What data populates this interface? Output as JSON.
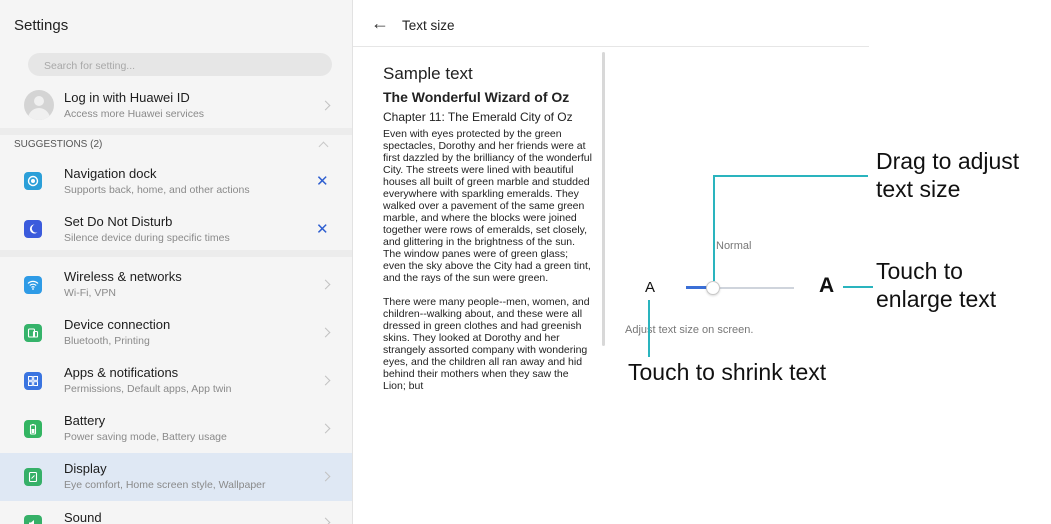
{
  "settings": {
    "title": "Settings",
    "search_placeholder": "Search for setting...",
    "account": {
      "title": "Log in with Huawei ID",
      "subtitle": "Access more Huawei services"
    },
    "suggestions_header": "SUGGESTIONS (2)",
    "suggestions": [
      {
        "title": "Navigation dock",
        "subtitle": "Supports back, home, and other actions",
        "icon": "navigation-dock-icon",
        "color": "#2b9fd8"
      },
      {
        "title": "Set Do Not Disturb",
        "subtitle": "Silence device during specific times",
        "icon": "moon-icon",
        "color": "#3b5bdc"
      }
    ],
    "items": [
      {
        "title": "Wireless & networks",
        "subtitle": "Wi-Fi, VPN",
        "icon": "wifi-icon",
        "color": "#2e9be6"
      },
      {
        "title": "Device connection",
        "subtitle": "Bluetooth, Printing",
        "icon": "device-connection-icon",
        "color": "#35b36a"
      },
      {
        "title": "Apps & notifications",
        "subtitle": "Permissions, Default apps, App twin",
        "icon": "apps-icon",
        "color": "#3a74e0"
      },
      {
        "title": "Battery",
        "subtitle": "Power saving mode, Battery usage",
        "icon": "battery-icon",
        "color": "#33b562"
      },
      {
        "title": "Display",
        "subtitle": "Eye comfort, Home screen style, Wallpaper",
        "icon": "display-icon",
        "color": "#36b068"
      },
      {
        "title": "Sound",
        "subtitle": "",
        "icon": "sound-icon",
        "color": "#36b068"
      }
    ]
  },
  "detail": {
    "title": "Text size",
    "sample_label": "Sample text",
    "book_title": "The Wonderful Wizard of Oz",
    "chapter": "Chapter 11: The Emerald City of Oz",
    "paragraph1": "Even with eyes protected by the green spectacles, Dorothy and her friends were at first dazzled by the brilliancy of the wonderful City. The streets were lined with beautiful houses all built of green marble and studded everywhere with sparkling emeralds. They walked over a pavement of the same green marble, and where the blocks were joined together were rows of emeralds, set closely, and glittering in the brightness of the sun. The window panes were of green glass; even the sky above the City had a green tint, and the rays of the sun were green.",
    "paragraph2": "There were many people--men, women, and children--walking about, and these were all dressed in green clothes and had greenish skins. They looked at Dorothy and her strangely assorted company with wondering eyes, and the children all ran away and hid behind their mothers when they saw the Lion; but",
    "size_level": "Normal",
    "small_label": "A",
    "large_label": "A",
    "hint": "Adjust text size on screen.",
    "slider_fraction": 0.25
  },
  "callouts": {
    "drag": "Drag to adjust text size",
    "enlarge": "Touch to enlarge text",
    "shrink": "Touch to shrink text"
  },
  "colors": {
    "accent": "#3b6fd6",
    "callout": "#2ab4be",
    "selected_row": "#dfe8f4",
    "dismiss": "#2f5fd0"
  }
}
